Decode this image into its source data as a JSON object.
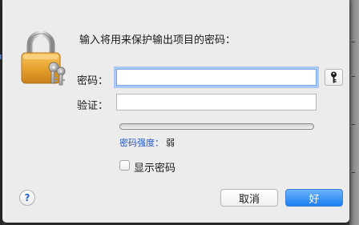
{
  "dialog": {
    "title": "输入将用来保护输出项目的密码：",
    "password_label": "密码：",
    "password_value": "",
    "verify_label": "验证：",
    "verify_value": "",
    "strength_label": "密码强度：",
    "strength_value": "弱",
    "strength_fraction": 0,
    "show_password_label": "显示密码",
    "show_password_checked": false,
    "help_label": "?",
    "cancel_label": "取消",
    "ok_label": "好"
  },
  "icons": {
    "lock": "padlock-with-keys-icon",
    "key": "key-icon"
  },
  "colors": {
    "accent": "#1b7ff2",
    "strength_label": "#2456c6",
    "focus_ring": "#a9c8f5"
  }
}
